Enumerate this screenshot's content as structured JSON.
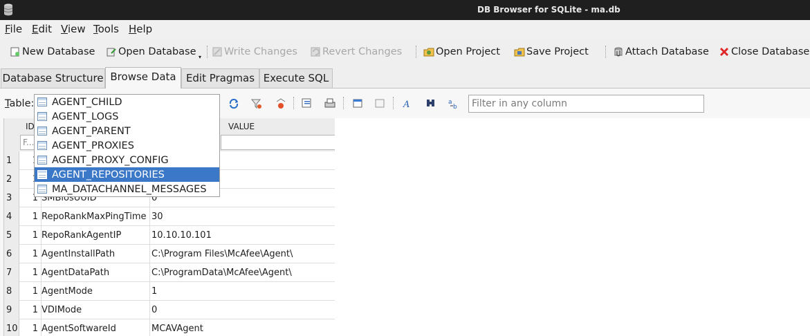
{
  "window": {
    "title": "DB Browser for SQLite - ma.db"
  },
  "menu": [
    "File",
    "Edit",
    "View",
    "Tools",
    "Help"
  ],
  "toolbar": {
    "new_database": "New Database",
    "open_database": "Open Database",
    "write_changes": "Write Changes",
    "revert_changes": "Revert Changes",
    "open_project": "Open Project",
    "save_project": "Save Project",
    "attach_database": "Attach Database",
    "close_database": "Close Database"
  },
  "tabs": [
    "Database Structure",
    "Browse Data",
    "Edit Pragmas",
    "Execute SQL"
  ],
  "browse": {
    "table_label": "Table:",
    "filter_placeholder": "Filter in any column",
    "columns": {
      "id": "ID",
      "value": "VALUE"
    },
    "filter_cell_placeholder": "F..."
  },
  "dropdown": {
    "items": [
      "AGENT_CHILD",
      "AGENT_LOGS",
      "AGENT_PARENT",
      "AGENT_PROXIES",
      "AGENT_PROXY_CONFIG",
      "AGENT_REPOSITORIES",
      "MA_DATACHANNEL_MESSAGES"
    ],
    "selected": "AGENT_REPOSITORIES"
  },
  "rows": [
    {
      "num": "1",
      "id": "1",
      "name": "",
      "value": ""
    },
    {
      "num": "2",
      "id": "1",
      "name": "",
      "value": ""
    },
    {
      "num": "3",
      "id": "1",
      "name": "SMBiosUUID",
      "value": "0"
    },
    {
      "num": "4",
      "id": "1",
      "name": "RepoRankMaxPingTime",
      "value": "30"
    },
    {
      "num": "5",
      "id": "1",
      "name": "RepoRankAgentIP",
      "value": "10.10.10.101"
    },
    {
      "num": "6",
      "id": "1",
      "name": "AgentInstallPath",
      "value": "C:\\Program Files\\McAfee\\Agent\\"
    },
    {
      "num": "7",
      "id": "1",
      "name": "AgentDataPath",
      "value": "C:\\ProgramData\\McAfee\\Agent\\"
    },
    {
      "num": "8",
      "id": "1",
      "name": "AgentMode",
      "value": "1"
    },
    {
      "num": "9",
      "id": "1",
      "name": "VDIMode",
      "value": "0"
    },
    {
      "num": "10",
      "id": "1",
      "name": "AgentSoftwareId",
      "value": "MCAVAgent"
    }
  ]
}
